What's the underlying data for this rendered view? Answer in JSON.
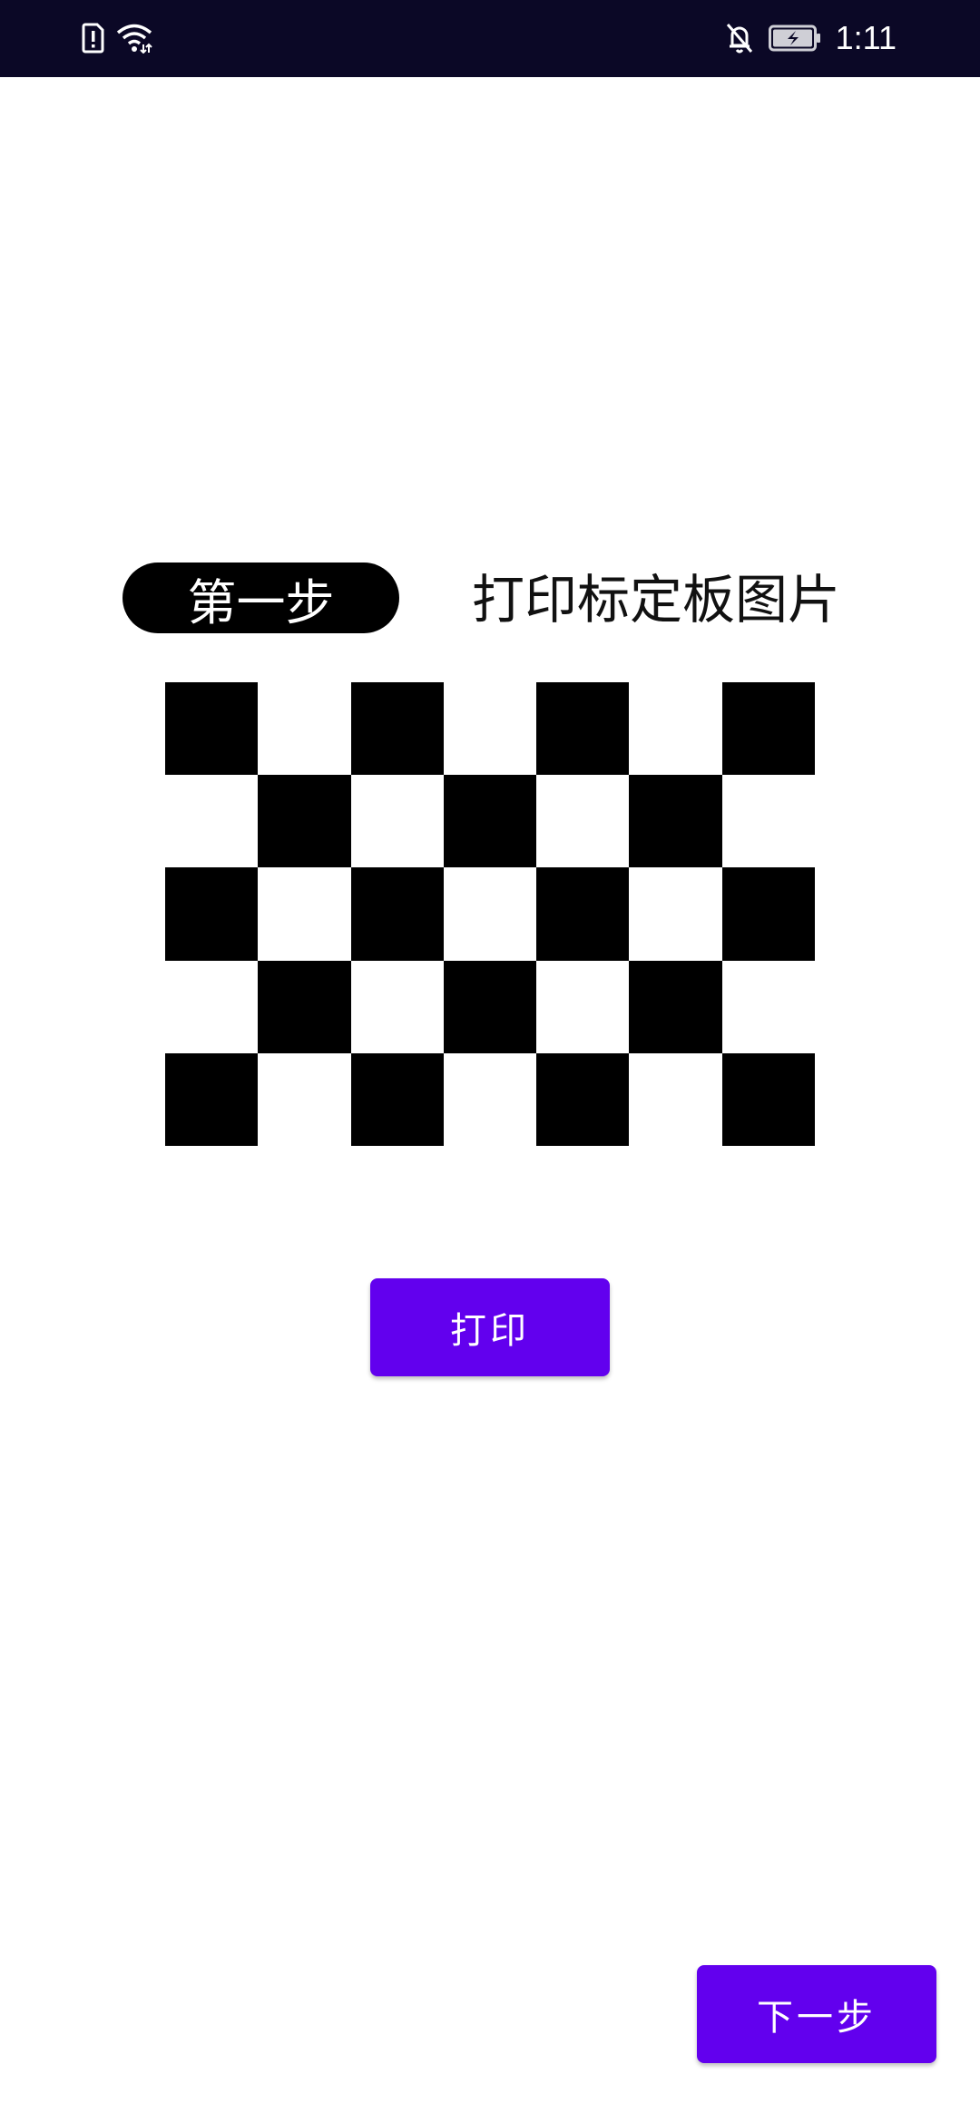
{
  "status_bar": {
    "time": "1:11",
    "icons": [
      "sim-alert-icon",
      "wifi-icon",
      "bell-off-icon",
      "battery-charging-icon"
    ]
  },
  "main": {
    "step_badge": "第一步",
    "step_title": "打印标定板图片",
    "calibration_board": {
      "rows": 5,
      "cols": 7,
      "pattern": "checkerboard, top-left black"
    },
    "print_button": "打印"
  },
  "footer": {
    "next_button": "下一步"
  },
  "colors": {
    "status_bar_bg": "#0b0826",
    "accent": "#6200ee",
    "board_dark": "#000000",
    "background": "#ffffff"
  }
}
